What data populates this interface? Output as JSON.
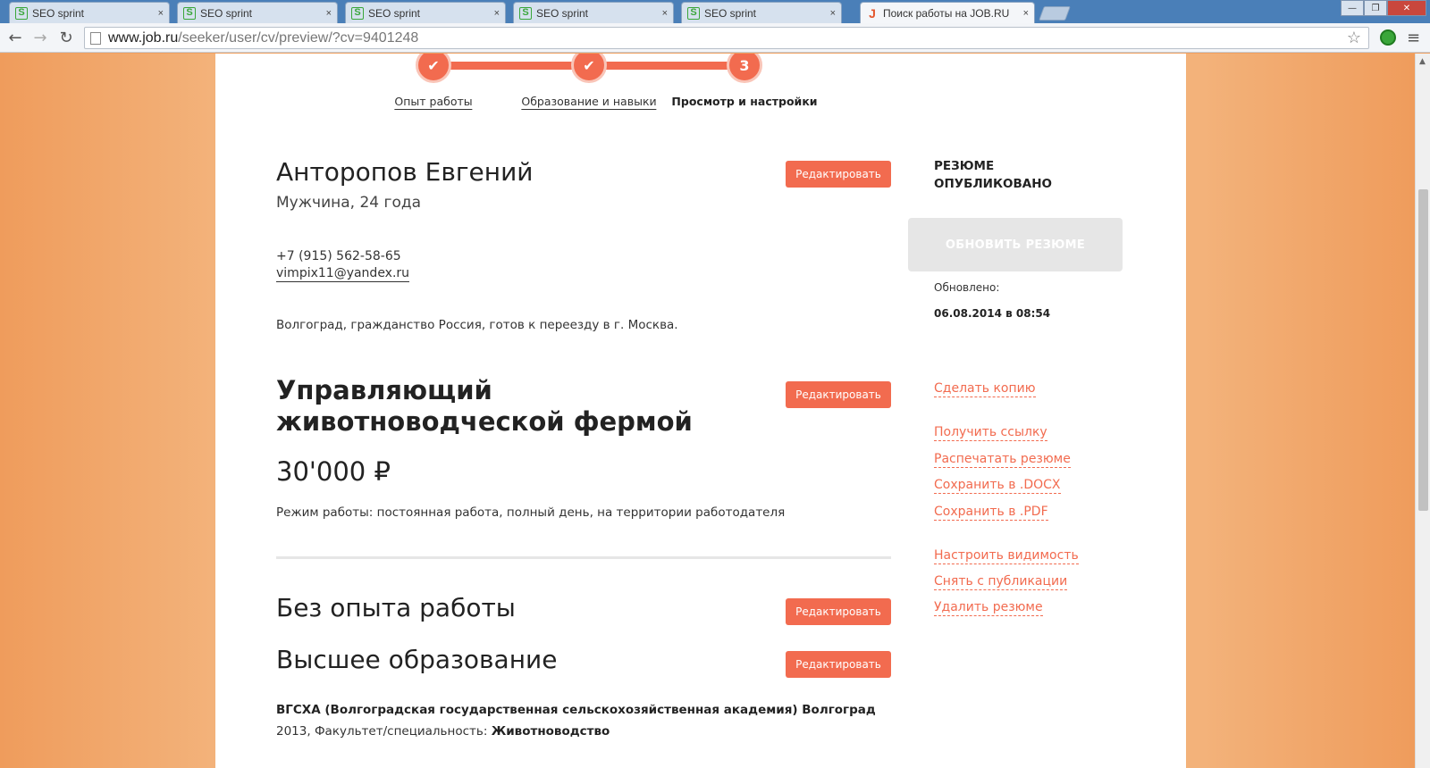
{
  "browser": {
    "tabs": [
      {
        "label": "SEO sprint",
        "close": "×",
        "icon": "S"
      },
      {
        "label": "SEO sprint",
        "close": "×",
        "icon": "S"
      },
      {
        "label": "SEO sprint",
        "close": "×",
        "icon": "S"
      },
      {
        "label": "SEO sprint",
        "close": "×",
        "icon": "S"
      },
      {
        "label": "SEO sprint",
        "close": "×",
        "icon": "S"
      },
      {
        "label": "Поиск работы на JOB.RU",
        "close": "×",
        "icon": "J"
      }
    ],
    "url_host": "www.job.ru",
    "url_path": "/seeker/user/cv/preview/?cv=9401248",
    "window_buttons": {
      "minimize": "—",
      "maximize": "❐",
      "close": "✕"
    },
    "nav": {
      "back": "←",
      "forward": "→",
      "reload": "↻",
      "star": "☆",
      "menu": "≡"
    }
  },
  "steps": [
    {
      "mark": "✔",
      "label": "Опыт работы"
    },
    {
      "mark": "✔",
      "label": "Образование и навыки"
    },
    {
      "mark": "3",
      "label": "Просмотр и настройки"
    }
  ],
  "resume": {
    "name": "Анторопов Евгений",
    "subinfo": "Мужчина, 24 года",
    "phone": "+7 (915) 562-58-65",
    "email": "vimpix11@yandex.ru",
    "location": "Волгоград, гражданство Россия, готов к переезду в г. Москва.",
    "position": "Управляющий животноводческой фермой",
    "salary": "30'000 ₽",
    "schedule": "Режим работы: постоянная работа, полный день, на территории работодателя",
    "experience_title": "Без опыта работы",
    "education_title": "Высшее образование",
    "education_institution": "ВГСХА (Волгоградская государственная сельскохозяйственная академия) Волгоград",
    "education_year_prefix": "2013, Факультет/специальность: ",
    "education_specialty": "Животноводство",
    "edit_label": "Редактировать"
  },
  "sidebar": {
    "status": "РЕЗЮМЕ ОПУБЛИКОВАНО",
    "update_button": "ОБНОВИТЬ РЕЗЮМЕ",
    "updated_label": "Обновлено:",
    "updated_value": "06.08.2014 в 08:54",
    "links": [
      "Сделать копию",
      "Получить ссылку",
      "Распечатать резюме",
      "Сохранить в .DOCX",
      "Сохранить в .PDF",
      "Настроить видимость",
      "Снять с публикации",
      "Удалить резюме"
    ]
  },
  "colors": {
    "accent": "#f26b4f",
    "background": "#f3b27a"
  }
}
